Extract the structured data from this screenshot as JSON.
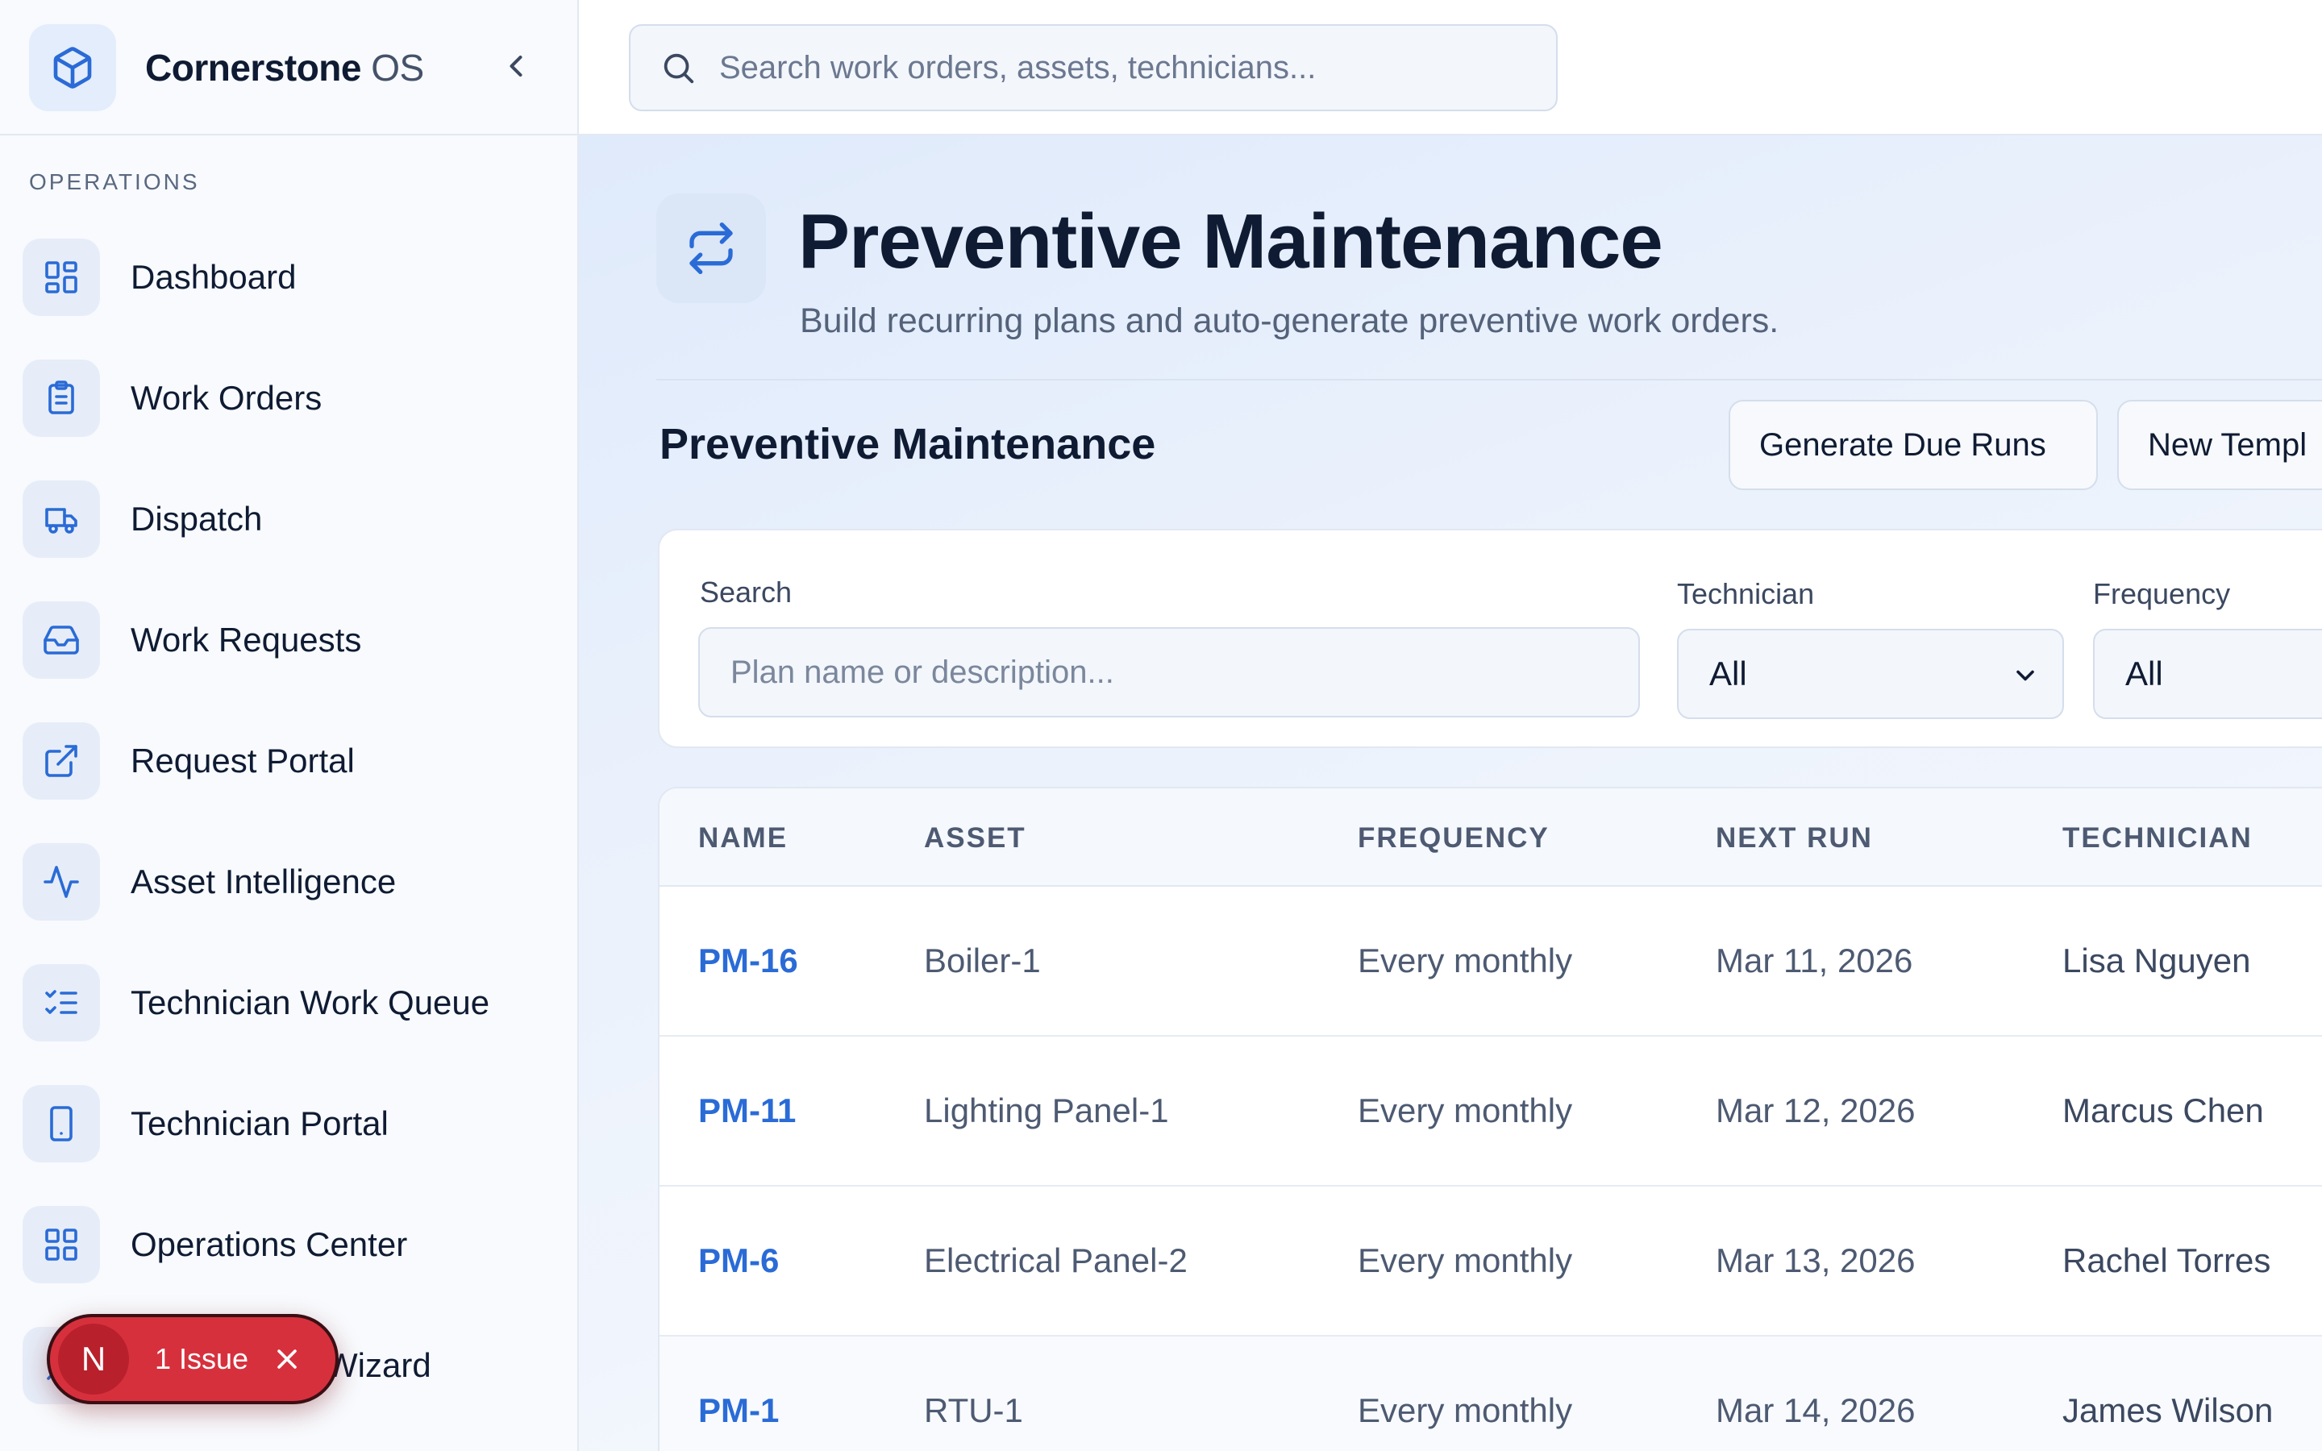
{
  "app": {
    "brand_bold": "Cornerstone",
    "brand_light": "OS"
  },
  "sidebar": {
    "section_label": "OPERATIONS",
    "items": [
      {
        "label": "Dashboard",
        "icon": "layout-dashboard-icon"
      },
      {
        "label": "Work Orders",
        "icon": "clipboard-list-icon"
      },
      {
        "label": "Dispatch",
        "icon": "truck-icon"
      },
      {
        "label": "Work Requests",
        "icon": "inbox-icon"
      },
      {
        "label": "Request Portal",
        "icon": "external-link-icon"
      },
      {
        "label": "Asset Intelligence",
        "icon": "activity-icon"
      },
      {
        "label": "Technician Work Queue",
        "icon": "list-checks-icon"
      },
      {
        "label": "Technician Portal",
        "icon": "smartphone-icon"
      },
      {
        "label": "Operations Center",
        "icon": "grid-icon"
      },
      {
        "label": "Wizard",
        "icon": "wand-icon"
      }
    ]
  },
  "issue_badge": {
    "letter": "N",
    "text": "1 Issue"
  },
  "topbar": {
    "search_placeholder": "Search work orders, assets, technicians..."
  },
  "page": {
    "title": "Preventive Maintenance",
    "subtitle": "Build recurring plans and auto-generate preventive work orders.",
    "section_title": "Preventive Maintenance",
    "generate_button": "Generate Due Runs",
    "new_template_button": "New Templ"
  },
  "filters": {
    "search_label": "Search",
    "search_placeholder": "Plan name or description...",
    "technician_label": "Technician",
    "technician_value": "All",
    "frequency_label": "Frequency",
    "frequency_value": "All"
  },
  "table": {
    "headers": [
      "NAME",
      "ASSET",
      "FREQUENCY",
      "NEXT RUN",
      "TECHNICIAN"
    ],
    "rows": [
      {
        "name": "PM-16",
        "asset": "Boiler-1",
        "frequency": "Every monthly",
        "next_run": "Mar 11, 2026",
        "technician": "Lisa Nguyen"
      },
      {
        "name": "PM-11",
        "asset": "Lighting Panel-1",
        "frequency": "Every monthly",
        "next_run": "Mar 12, 2026",
        "technician": "Marcus Chen"
      },
      {
        "name": "PM-6",
        "asset": "Electrical Panel-2",
        "frequency": "Every monthly",
        "next_run": "Mar 13, 2026",
        "technician": "Rachel Torres"
      },
      {
        "name": "PM-1",
        "asset": "RTU-1",
        "frequency": "Every monthly",
        "next_run": "Mar 14, 2026",
        "technician": "James Wilson"
      }
    ]
  },
  "colors": {
    "accent": "#2a6bd6",
    "issue": "#d7303d",
    "text_primary": "#0f1b33",
    "text_muted": "#4d5a72"
  }
}
